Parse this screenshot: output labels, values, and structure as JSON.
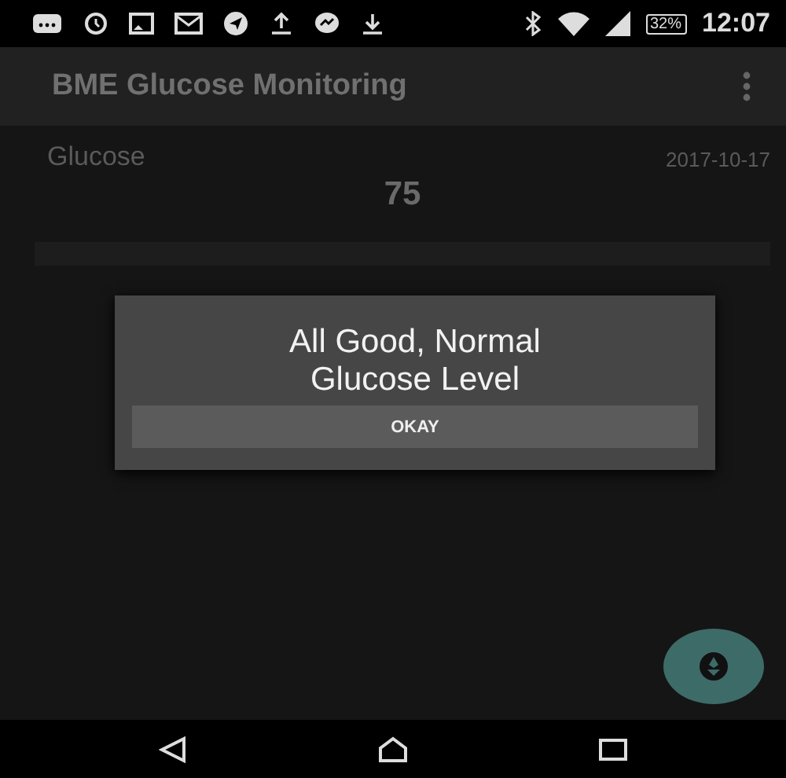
{
  "status_bar": {
    "battery": "32%",
    "time": "12:07"
  },
  "app_bar": {
    "title": "BME Glucose Monitoring"
  },
  "reading": {
    "label": "Glucose",
    "date": "2017-10-17",
    "value": "75"
  },
  "dialog": {
    "message": "All Good, Normal Glucose Level",
    "button": "OKAY"
  }
}
